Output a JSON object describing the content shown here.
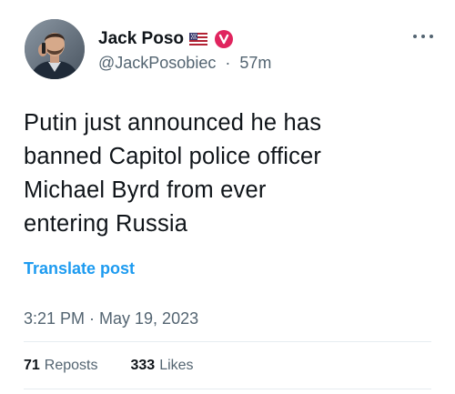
{
  "author": {
    "display_name": "Jack Poso",
    "handle": "@JackPosobiec",
    "separator": "·",
    "time_ago": "57m",
    "flag_icon": "us-flag-icon",
    "badge_icon": "verified-badge-icon",
    "badge_color": "#e0245e"
  },
  "tweet": {
    "text_lines": [
      "Putin just announced he has",
      "banned Capitol police officer",
      "Michael Byrd from ever",
      "entering Russia"
    ],
    "translate_label": "Translate post",
    "timestamp": "3:21 PM · May 19, 2023"
  },
  "stats": {
    "reposts_count": "71",
    "reposts_label": "Reposts",
    "likes_count": "333",
    "likes_label": "Likes"
  },
  "icons": {
    "more": "more-options-icon"
  },
  "colors": {
    "link": "#1d9bf0",
    "secondary_text": "#536471",
    "primary_text": "#0f1419"
  }
}
